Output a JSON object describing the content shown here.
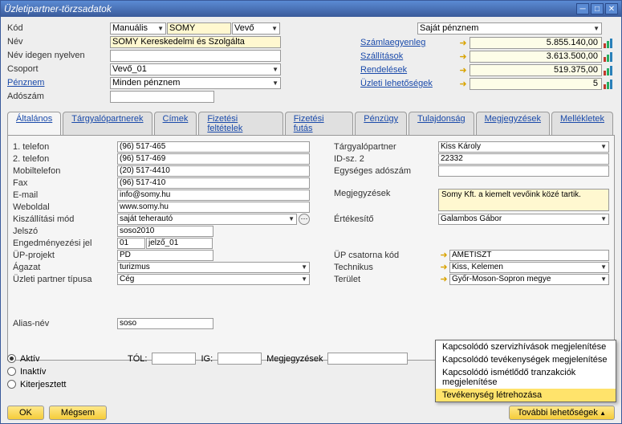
{
  "window": {
    "title": "Üzletipartner-törzsadatok"
  },
  "header": {
    "left": {
      "kod_label": "Kód",
      "kod_mode": "Manuális",
      "kod_value": "SOMY",
      "kod_type": "Vevő",
      "nev_label": "Név",
      "nev_value": "SOMY Kereskedelmi és Szolgálta",
      "nev_idegen_label": "Név idegen nyelven",
      "nev_idegen_value": "",
      "csoport_label": "Csoport",
      "csoport_value": "Vevő_01",
      "penznem_label": "Pénznem",
      "penznem_value": "Minden pénznem",
      "adoszam_label": "Adószám",
      "adoszam_value": ""
    },
    "right": {
      "sajat_penznem": "Saját pénznem",
      "szamlaegyenleg_label": "Számlaegyenleg",
      "szamlaegyenleg_value": "5.855.140,00",
      "szallitasok_label": "Szállítások",
      "szallitasok_value": "3.613.500,00",
      "rendelesek_label": "Rendelések",
      "rendelesek_value": "519.375,00",
      "uzleti_lehetosegek_label": "Üzleti lehetőségek",
      "uzleti_lehetosegek_value": "5"
    }
  },
  "tabs": {
    "altalanos": "Általános",
    "targyalopartnerek": "Tárgyalópartnerek",
    "cimek": "Címek",
    "fizetesi_feltetelek": "Fizetési feltételek",
    "fizetesi_futas": "Fizetési futás",
    "penzugy": "Pénzügy",
    "tulajdonsag": "Tulajdonság",
    "megjegyzesek": "Megjegyzések",
    "mellekletek": "Mellékletek"
  },
  "general": {
    "left": {
      "tel1_label": "1. telefon",
      "tel1_value": "(96) 517-465",
      "tel2_label": "2. telefon",
      "tel2_value": "(96) 517-469",
      "mobil_label": "Mobiltelefon",
      "mobil_value": "(20) 517-4410",
      "fax_label": "Fax",
      "fax_value": "(96) 517-410",
      "email_label": "E-mail",
      "email_value": "info@somy.hu",
      "web_label": "Weboldal",
      "web_value": "www.somy.hu",
      "kiszallitasi_label": "Kiszállítási mód",
      "kiszallitasi_value": "saját teherautó",
      "jelszo_label": "Jelszó",
      "jelszo_value": "soso2010",
      "engedmeny_label": "Engedményezési jel",
      "engedmeny_value1": "01",
      "engedmeny_value2": "jelző_01",
      "up_projekt_label": "ÜP-projekt",
      "up_projekt_value": "PD",
      "agazat_label": "Ágazat",
      "agazat_value": "turizmus",
      "up_tipusa_label": "Üzleti partner típusa",
      "up_tipusa_value": "Cég",
      "alias_label": "Alias-név",
      "alias_value": "soso"
    },
    "right": {
      "targyalopartner_label": "Tárgyalópartner",
      "targyalopartner_value": "Kiss Károly",
      "idsz2_label": "ID-sz. 2",
      "idsz2_value": "22332",
      "egyseges_label": "Egységes adószám",
      "egyseges_value": "",
      "megjegyzesek_label": "Megjegyzések",
      "megjegyzesek_value": "Somy Kft. a kiemelt vevőink közé tartik.",
      "ertekesito_label": "Értékesítő",
      "ertekesito_value": "Galambos Gábor",
      "up_csatorna_label": "ÜP csatorna kód",
      "up_csatorna_value": "AMETISZT",
      "technikus_label": "Technikus",
      "technikus_value": "Kiss, Kelemen",
      "terulet_label": "Terület",
      "terulet_value": "Győr-Moson-Sopron megye"
    }
  },
  "status": {
    "aktiv": "Aktív",
    "inaktiv": "Inaktív",
    "kiterjesztett": "Kiterjesztett",
    "tol": "TÓL:",
    "ig": "IG:",
    "megjegyzesek": "Megjegyzések"
  },
  "context_menu": {
    "mi1": "Kapcsolódó szervizhívások megjelenítése",
    "mi2": "Kapcsolódó tevékenységek megjelenítése",
    "mi3": "Kapcsolódó ismétlődő tranzakciók megjelenítése",
    "mi4": "Tevékenység létrehozása"
  },
  "footer": {
    "ok": "OK",
    "megsem": "Mégsem",
    "tovabbi": "További lehetőségek"
  }
}
